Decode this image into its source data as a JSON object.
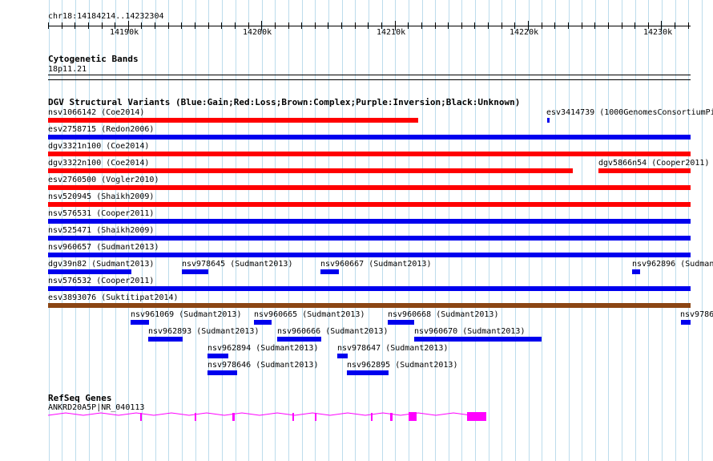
{
  "colors": {
    "gain": "#0000ee",
    "loss": "#ff0000",
    "complex": "#8b4513",
    "gene": "#ff00ff",
    "grid": "#bcdcec"
  },
  "ruler": {
    "location": "chr18:14184214..14232304",
    "tick_labels": [
      "14190k",
      "14200k",
      "14210k",
      "14220k",
      "14230k"
    ]
  },
  "cyto": {
    "title": "Cytogenetic Bands",
    "band": "18p11.21"
  },
  "dgv": {
    "title": "DGV Structural Variants (Blue:Gain;Red:Loss;Brown:Complex;Purple:Inversion;Black:Unknown)",
    "features": [
      {
        "label": "nsv1066142 (Coe2014)",
        "type": "loss"
      },
      {
        "label": "esv3414739 (1000GenomesConsortiumPi",
        "type": "gain"
      },
      {
        "label": "esv2758715 (Redon2006)",
        "type": "gain"
      },
      {
        "label": "dgv3321n100 (Coe2014)",
        "type": "loss"
      },
      {
        "label": "dgv3322n100 (Coe2014)",
        "type": "loss"
      },
      {
        "label": "dgv5866n54 (Cooper2011)",
        "type": "loss"
      },
      {
        "label": "esv2760500 (Vogler2010)",
        "type": "loss"
      },
      {
        "label": "nsv520945 (Shaikh2009)",
        "type": "loss"
      },
      {
        "label": "nsv576531 (Cooper2011)",
        "type": "gain"
      },
      {
        "label": "nsv525471 (Shaikh2009)",
        "type": "gain"
      },
      {
        "label": "nsv960657 (Sudmant2013)",
        "type": "gain"
      },
      {
        "label": "dgv39n82 (Sudmant2013)",
        "type": "gain"
      },
      {
        "label": "nsv978645 (Sudmant2013)",
        "type": "gain"
      },
      {
        "label": "nsv960667 (Sudmant2013)",
        "type": "gain"
      },
      {
        "label": "nsv962896 (Sudman",
        "type": "gain"
      },
      {
        "label": "nsv576532 (Cooper2011)",
        "type": "gain"
      },
      {
        "label": "esv3893076 (Suktitipat2014)",
        "type": "complex"
      },
      {
        "label": "nsv961069 (Sudmant2013)",
        "type": "gain"
      },
      {
        "label": "nsv960665 (Sudmant2013)",
        "type": "gain"
      },
      {
        "label": "nsv960668 (Sudmant2013)",
        "type": "gain"
      },
      {
        "label": "nsv9786",
        "type": "gain"
      },
      {
        "label": "nsv962893 (Sudmant2013)",
        "type": "gain"
      },
      {
        "label": "nsv960666 (Sudmant2013)",
        "type": "gain"
      },
      {
        "label": "nsv960670 (Sudmant2013)",
        "type": "gain"
      },
      {
        "label": "nsv962894 (Sudmant2013)",
        "type": "gain"
      },
      {
        "label": "nsv978647 (Sudmant2013)",
        "type": "gain"
      },
      {
        "label": "nsv978646 (Sudmant2013)",
        "type": "gain"
      },
      {
        "label": "nsv962895 (Sudmant2013)",
        "type": "gain"
      }
    ]
  },
  "refseq": {
    "title": "RefSeq Genes",
    "gene_label": "ANKRD20A5P|NR_040113"
  }
}
